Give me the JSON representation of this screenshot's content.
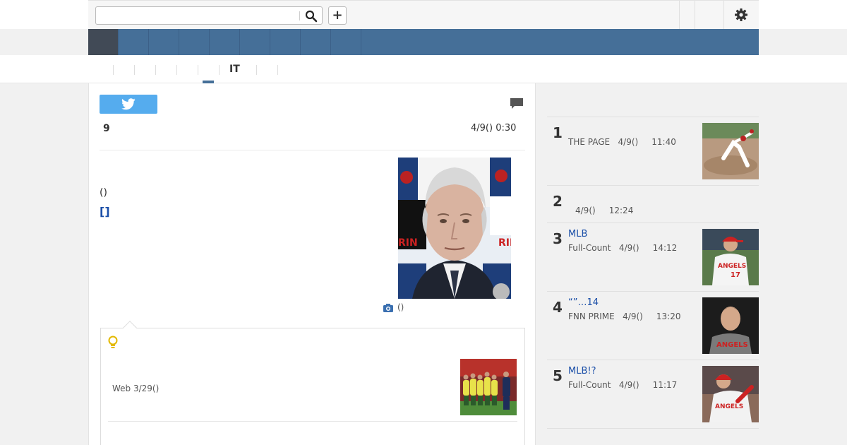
{
  "search": {
    "value": "",
    "placeholder": ""
  },
  "toolbar": {
    "plus_label": "+"
  },
  "subnav": {
    "active_label": "IT"
  },
  "article": {
    "count": "9",
    "date": "4/9() 0:30",
    "paren_text": "()",
    "link_text": "[]",
    "caption": "()"
  },
  "related": {
    "source": "Web 3/29()"
  },
  "ranking": [
    {
      "num": "1",
      "title": "",
      "meta": "THE PAGE   4/9()     11:40"
    },
    {
      "num": "2",
      "title": "",
      "meta": "4/9()     12:24"
    },
    {
      "num": "3",
      "title": "MLB",
      "meta": "Full-Count   4/9()     14:12"
    },
    {
      "num": "4",
      "title": "“”…14",
      "meta": "FNN PRIME   4/9()     13:20"
    },
    {
      "num": "5",
      "title": "MLB!?",
      "meta": "Full-Count   4/9()     11:17"
    }
  ],
  "colors": {
    "nav_blue": "#456f98",
    "nav_active": "#414a56",
    "twitter_blue": "#55acee",
    "link_blue": "#1b4fa8"
  }
}
